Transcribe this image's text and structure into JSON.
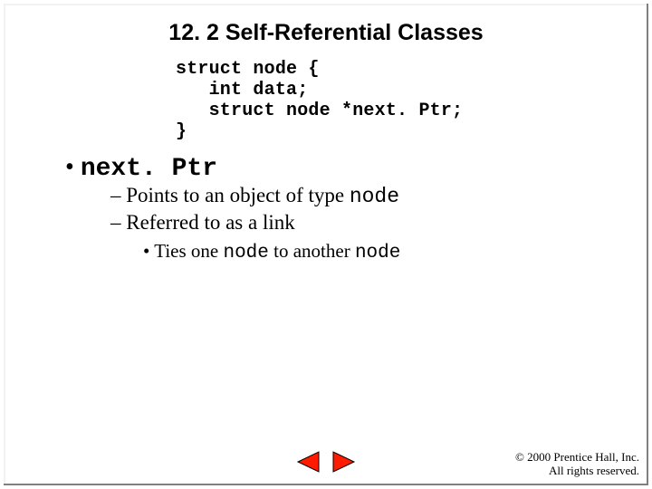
{
  "title": "12. 2   Self-Referential Classes",
  "code": "struct node {   \n   int data;\n   struct node *next. Ptr;\n}",
  "bullet1": {
    "marker": "•",
    "term": "next. Ptr"
  },
  "dash1": {
    "marker": "–",
    "pre": "  Points to an object of type ",
    "mono": "node"
  },
  "dash2": {
    "marker": "–",
    "text": "  Referred to as a link"
  },
  "sub1": {
    "marker": "•",
    "pre": "  Ties one ",
    "mono1": "node",
    "mid": " to another ",
    "mono2": "node"
  },
  "footer": {
    "line1": "© 2000 Prentice Hall, Inc.",
    "line2": "All rights reserved."
  },
  "nav": {
    "prev": "previous-slide",
    "next": "next-slide"
  },
  "colors": {
    "nav_fill": "#ff1a00",
    "nav_stroke": "#000000"
  }
}
